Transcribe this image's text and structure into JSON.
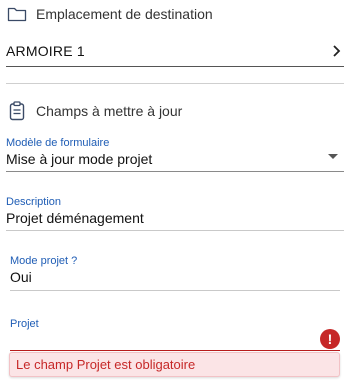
{
  "destination": {
    "section_title": "Emplacement de destination",
    "value": "ARMOIRE 1",
    "icon": "folder-icon"
  },
  "fields_section": {
    "title": "Champs à mettre à jour",
    "icon": "clipboard-icon"
  },
  "form": {
    "model": {
      "label": "Modèle de formulaire",
      "value": "Mise à jour mode projet"
    },
    "description": {
      "label": "Description",
      "value": "Projet déménagement"
    },
    "mode_projet": {
      "label": "Mode projet ?",
      "value": "Oui"
    },
    "projet": {
      "label": "Projet",
      "value": "",
      "error_icon_text": "!",
      "error_message": "Le champ Projet est obligatoire"
    }
  },
  "colors": {
    "accent": "#1f5db5",
    "error": "#c62828",
    "error_bg": "#fbe4e6"
  }
}
